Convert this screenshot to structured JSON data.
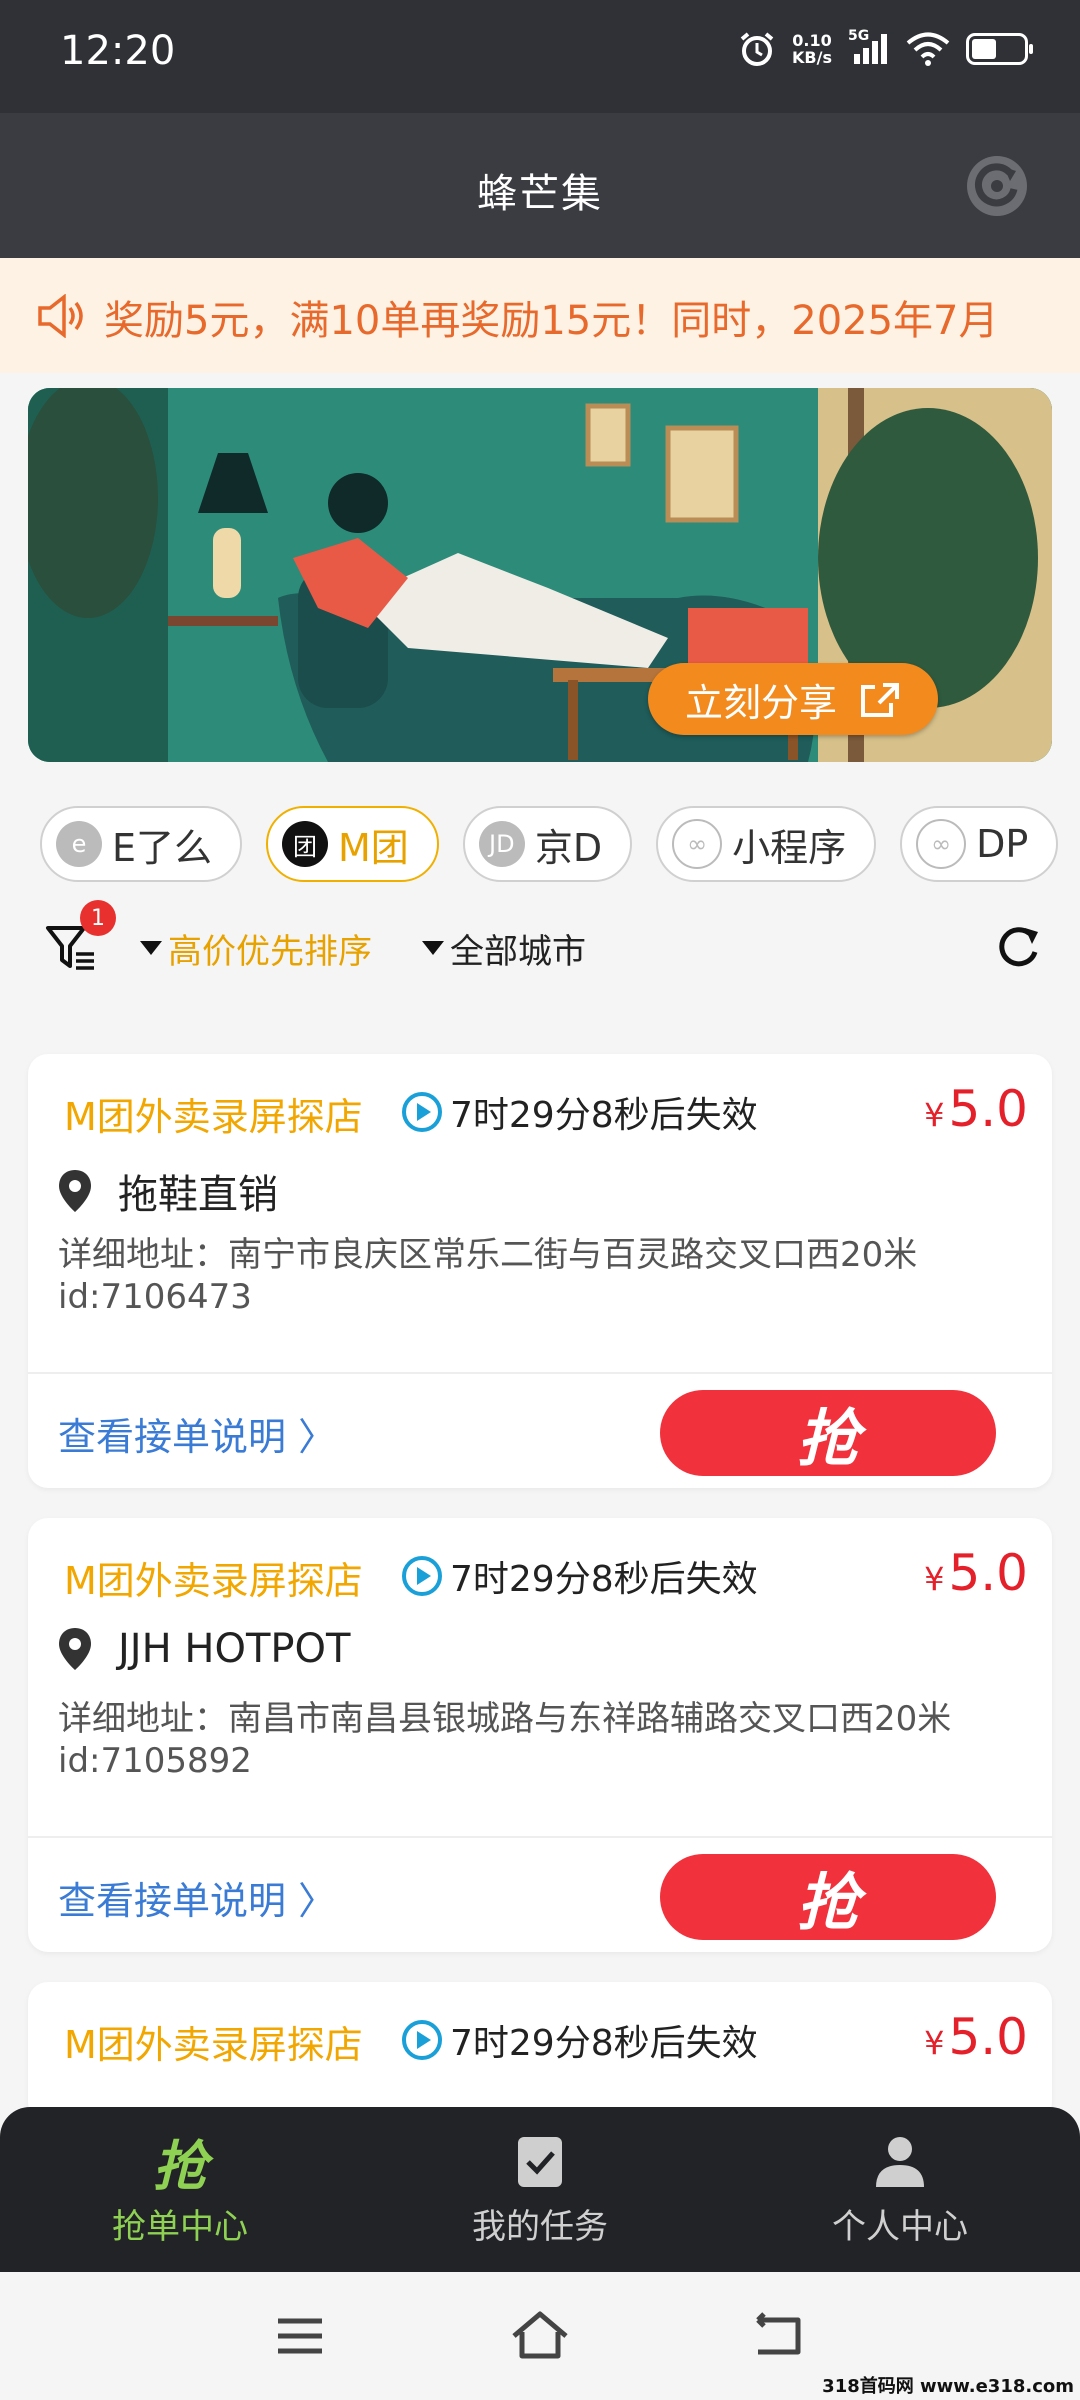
{
  "status_bar": {
    "time": "12:20",
    "net_speed_top": "0.10",
    "net_speed_bottom": "KB/s",
    "signal": "5G"
  },
  "app": {
    "title": "蜂芒集"
  },
  "notice": {
    "text": "奖励5元，满10单再奖励15元！同时，2025年7月"
  },
  "banner": {
    "share_label": "立刻分享"
  },
  "tabs": [
    {
      "icon": "e-logo-icon",
      "icon_text": "e",
      "label": "E了么"
    },
    {
      "icon": "tuan-logo-icon",
      "icon_text": "团",
      "label": "M团",
      "active": true
    },
    {
      "icon": "jd-logo-icon",
      "icon_text": "JD",
      "label": "京D"
    },
    {
      "icon": "mini-program-icon",
      "icon_text": "∞",
      "label": "小程序"
    },
    {
      "icon": "mini-program-icon",
      "icon_text": "∞",
      "label": "DP"
    }
  ],
  "filters": {
    "badge": "1",
    "sort": "高价优先排序",
    "city": "全部城市"
  },
  "cards": [
    {
      "title": "M团外卖录屏探店",
      "timer": "7时29分8秒后失效",
      "currency": "¥",
      "price": "5.0",
      "place": "拖鞋直销",
      "addr": "详细地址：南宁市良庆区常乐二街与百灵路交叉口西20米",
      "id": "id:7106473",
      "guide": "查看接单说明",
      "grab": "抢"
    },
    {
      "title": "M团外卖录屏探店",
      "timer": "7时29分8秒后失效",
      "currency": "¥",
      "price": "5.0",
      "place": "JJH HOTPOT",
      "addr": "详细地址：南昌市南昌县银城路与东祥路辅路交叉口西20米",
      "id": "id:7105892",
      "guide": "查看接单说明",
      "grab": "抢"
    },
    {
      "title": "M团外卖录屏探店",
      "timer": "7时29分8秒后失效",
      "currency": "¥",
      "price": "5.0"
    }
  ],
  "bottom_nav": [
    {
      "label": "抢单中心",
      "icon": "grab-icon",
      "glyph": "抢",
      "active": true
    },
    {
      "label": "我的任务",
      "icon": "task-check-icon"
    },
    {
      "label": "个人中心",
      "icon": "user-icon"
    }
  ],
  "watermark": "318首码网 www.e318.com",
  "colors": {
    "accent_orange": "#f2a600",
    "price_red": "#e4202a",
    "grab_red": "#f1323c",
    "nav_active": "#8ed153",
    "link_blue": "#3a7bd5"
  }
}
